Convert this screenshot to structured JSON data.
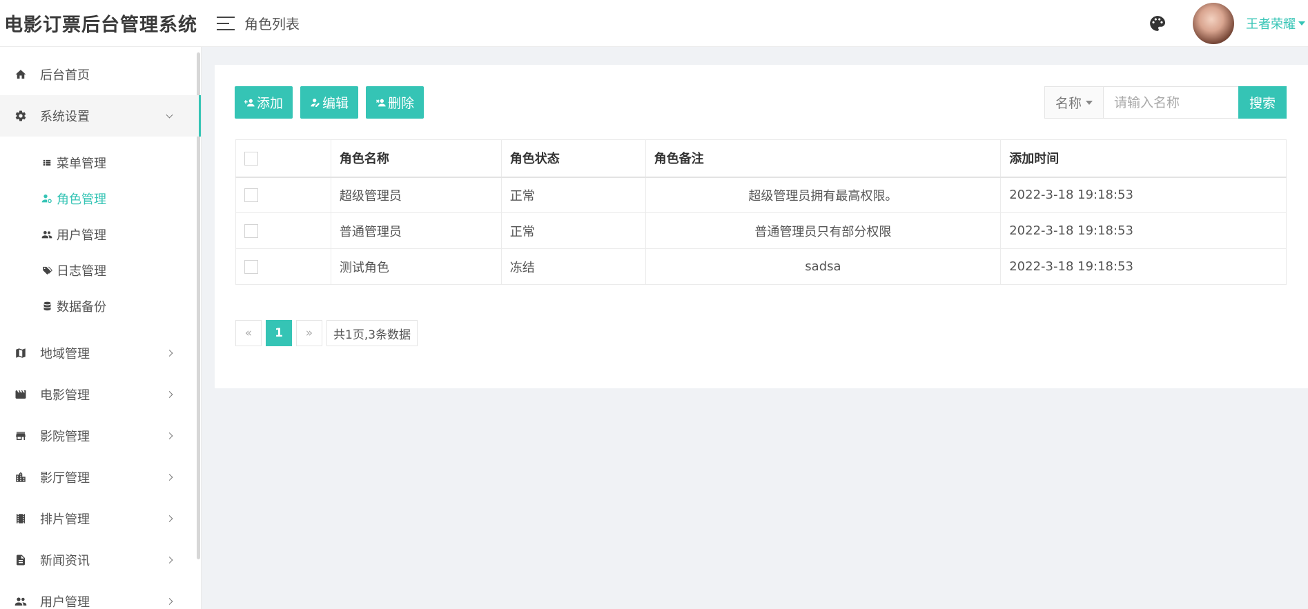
{
  "app": {
    "title": "电影订票后台管理系统"
  },
  "header": {
    "page_title": "角色列表",
    "user_name": "王者荣耀"
  },
  "sidebar": {
    "items": [
      {
        "label": "后台首页",
        "icon": "home-icon"
      },
      {
        "label": "系统设置",
        "icon": "gear-icon",
        "open": true,
        "children": [
          {
            "label": "菜单管理",
            "icon": "list-icon"
          },
          {
            "label": "角色管理",
            "icon": "user-gear-icon",
            "active": true
          },
          {
            "label": "用户管理",
            "icon": "users-icon"
          },
          {
            "label": "日志管理",
            "icon": "tag-icon"
          },
          {
            "label": "数据备份",
            "icon": "database-icon"
          }
        ]
      },
      {
        "label": "地域管理",
        "icon": "map-icon"
      },
      {
        "label": "电影管理",
        "icon": "film-icon"
      },
      {
        "label": "影院管理",
        "icon": "store-icon"
      },
      {
        "label": "影厅管理",
        "icon": "building-icon"
      },
      {
        "label": "排片管理",
        "icon": "film-strip-icon"
      },
      {
        "label": "新闻资讯",
        "icon": "document-icon"
      },
      {
        "label": "用户管理",
        "icon": "users-icon"
      }
    ]
  },
  "toolbar": {
    "add_label": "添加",
    "edit_label": "编辑",
    "delete_label": "删除"
  },
  "search": {
    "field_label": "名称",
    "placeholder": "请输入名称",
    "button_label": "搜索"
  },
  "table": {
    "headers": [
      "",
      "角色名称",
      "角色状态",
      "角色备注",
      "添加时间"
    ],
    "rows": [
      {
        "name": "超级管理员",
        "status": "正常",
        "remark": "超级管理员拥有最高权限。",
        "time": "2022-3-18 19:18:53"
      },
      {
        "name": "普通管理员",
        "status": "正常",
        "remark": "普通管理员只有部分权限",
        "time": "2022-3-18 19:18:53"
      },
      {
        "name": "测试角色",
        "status": "冻结",
        "remark": "sadsa",
        "time": "2022-3-18 19:18:53"
      }
    ]
  },
  "pagination": {
    "prev": "«",
    "current": "1",
    "next": "»",
    "info": "共1页,3条数据"
  },
  "colors": {
    "accent": "#35c4b5",
    "status_ok": "#2bbb78",
    "status_frozen": "#f09a3c"
  }
}
